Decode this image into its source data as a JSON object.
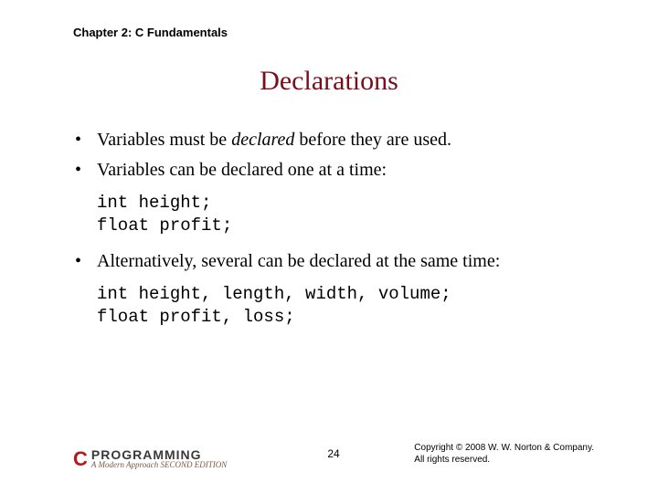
{
  "header": {
    "chapter": "Chapter 2: C Fundamentals"
  },
  "title": "Declarations",
  "bullets": {
    "b1_pre": "Variables must be ",
    "b1_em": "declared",
    "b1_post": " before they are used.",
    "b2": "Variables can be declared one at a time:",
    "b3": "Alternatively, several can be declared at the same time:"
  },
  "code": {
    "block1": "int height;\nfloat profit;",
    "block2": "int height, length, width, volume;\nfloat profit, loss;"
  },
  "footer": {
    "logo_c": "C",
    "logo_main": "PROGRAMMING",
    "logo_sub": "A Modern Approach   SECOND EDITION",
    "page": "24",
    "copyright_line1": "Copyright © 2008 W. W. Norton & Company.",
    "copyright_line2": "All rights reserved."
  }
}
